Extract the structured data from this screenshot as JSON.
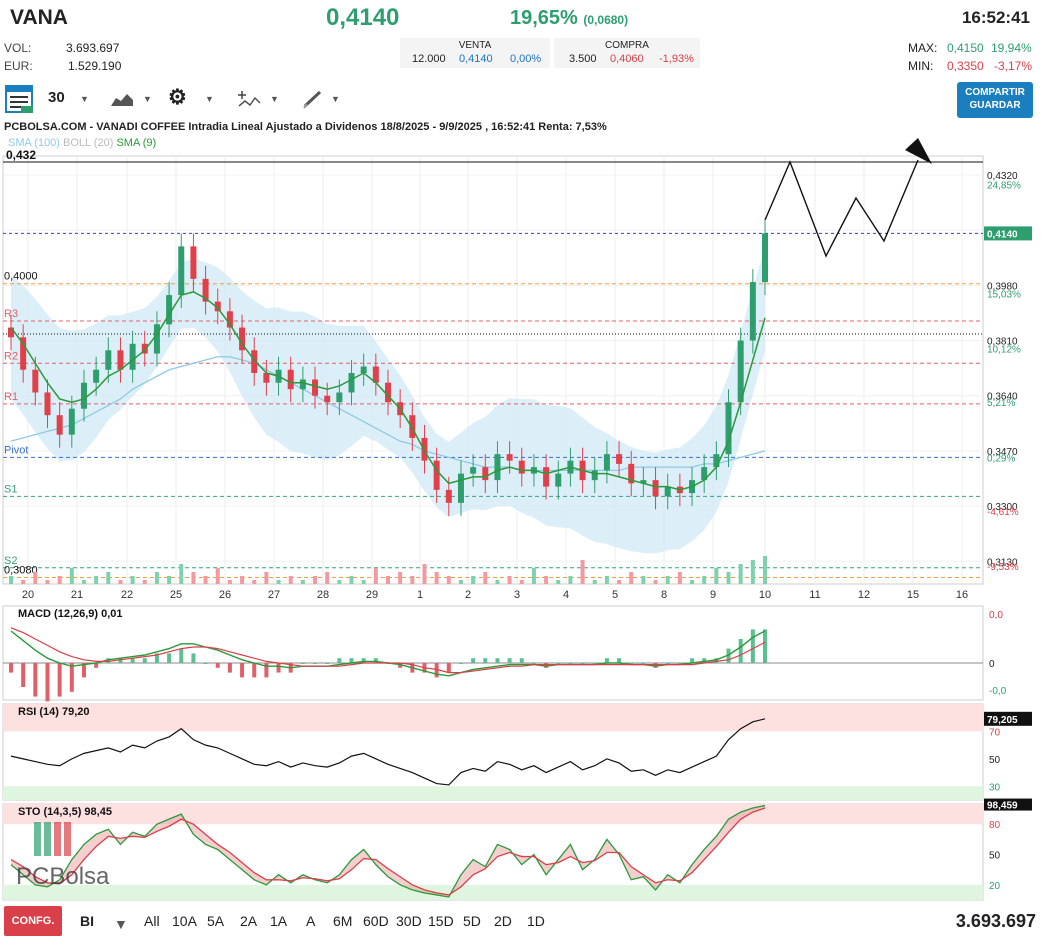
{
  "header": {
    "ticker": "VANA",
    "price": "0,4140",
    "change_pct": "19,65%",
    "change_abs": "(0,0680)",
    "time": "16:52:41",
    "vol_label": "VOL:",
    "vol_value": "3.693.697",
    "eur_label": "EUR:",
    "eur_value": "1.529.190",
    "venta": {
      "label": "VENTA",
      "qty": "12.000",
      "price": "0,4140",
      "pct": "0,00%"
    },
    "compra": {
      "label": "COMPRA",
      "qty": "3.500",
      "price": "0,4060",
      "pct": "-1,93%"
    },
    "max_label": "MAX:",
    "max_value": "0,4150",
    "max_pct": "19,94%",
    "min_label": "MIN:",
    "min_value": "0,3350",
    "min_pct": "-3,17%"
  },
  "toolbar": {
    "interval": "30",
    "share_line1": "COMPARTIR",
    "share_line2": "GUARDAR"
  },
  "chart_title": "PCBOLSA.COM - VANADI COFFEE Intradia Lineal Ajustado a Dividenos 18/8/2025 - 9/9/2025 , 16:52:41 Renta: 7,53%",
  "indicators": {
    "sma100": "SMA (100)",
    "boll": "BOLL (20)",
    "sma9": "SMA (9)"
  },
  "colors": {
    "up": "#2e9e6e",
    "down": "#e0404a",
    "sma9": "#2a9a3a",
    "sma100": "#8ecae6",
    "boll": "#cde8f7"
  },
  "chart_data": [
    {
      "type": "candlestick",
      "name": "price",
      "x_ticks": [
        "20",
        "21",
        "22",
        "25",
        "26",
        "27",
        "28",
        "29",
        "1",
        "2",
        "3",
        "4",
        "5",
        "8",
        "9",
        "10",
        "11",
        "12",
        "15",
        "16"
      ],
      "y_ticks": [
        "0,4320",
        "0,4150",
        "0,3980",
        "0,3810",
        "0,3640",
        "0,3470",
        "0,3300",
        "0,3130"
      ],
      "pct_ticks": [
        "24,85%",
        "15,03%",
        "10,12%",
        "5,21%",
        "0,29%",
        "-4,61%",
        "-9,53%"
      ],
      "ylim": [
        0.306,
        0.436
      ],
      "last_value": "0,4140",
      "top_left_label": "0,432",
      "levels": [
        {
          "label": "0,4000",
          "value": 0.3985,
          "style": "orange"
        },
        {
          "label": "R3",
          "value": 0.387,
          "style": "red"
        },
        {
          "label": "",
          "value": 0.383,
          "style": "black-dotted"
        },
        {
          "label": "R2",
          "value": 0.374,
          "style": "red"
        },
        {
          "label": "R1",
          "value": 0.3615,
          "style": "red"
        },
        {
          "label": "Pivot",
          "value": 0.345,
          "style": "blue"
        },
        {
          "label": "S1",
          "value": 0.333,
          "style": "green"
        },
        {
          "label": "S2",
          "value": 0.311,
          "style": "green"
        },
        {
          "label": "0,3080",
          "value": 0.308,
          "style": "orange"
        }
      ],
      "close": [
        0.382,
        0.372,
        0.365,
        0.358,
        0.352,
        0.36,
        0.368,
        0.372,
        0.378,
        0.372,
        0.38,
        0.377,
        0.386,
        0.395,
        0.41,
        0.4,
        0.393,
        0.39,
        0.385,
        0.378,
        0.371,
        0.368,
        0.372,
        0.366,
        0.369,
        0.364,
        0.362,
        0.365,
        0.371,
        0.373,
        0.368,
        0.362,
        0.358,
        0.351,
        0.344,
        0.335,
        0.331,
        0.34,
        0.342,
        0.338,
        0.346,
        0.344,
        0.34,
        0.342,
        0.336,
        0.34,
        0.344,
        0.338,
        0.341,
        0.346,
        0.343,
        0.337,
        0.338,
        0.333,
        0.336,
        0.334,
        0.338,
        0.342,
        0.346,
        0.362,
        0.381,
        0.399,
        0.414
      ],
      "sma9": [
        0.385,
        0.38,
        0.374,
        0.368,
        0.363,
        0.362,
        0.363,
        0.366,
        0.37,
        0.372,
        0.375,
        0.378,
        0.383,
        0.389,
        0.395,
        0.396,
        0.394,
        0.391,
        0.386,
        0.38,
        0.375,
        0.371,
        0.37,
        0.368,
        0.368,
        0.367,
        0.366,
        0.367,
        0.369,
        0.371,
        0.368,
        0.364,
        0.36,
        0.354,
        0.347,
        0.341,
        0.337,
        0.338,
        0.339,
        0.339,
        0.341,
        0.342,
        0.341,
        0.341,
        0.34,
        0.341,
        0.342,
        0.341,
        0.34,
        0.34,
        0.339,
        0.338,
        0.337,
        0.336,
        0.336,
        0.335,
        0.336,
        0.338,
        0.342,
        0.35,
        0.362,
        0.375,
        0.388
      ],
      "sma100": [
        0.35,
        0.351,
        0.352,
        0.353,
        0.354,
        0.355,
        0.357,
        0.359,
        0.361,
        0.363,
        0.366,
        0.368,
        0.37,
        0.372,
        0.373,
        0.374,
        0.375,
        0.376,
        0.376,
        0.375,
        0.374,
        0.372,
        0.37,
        0.368,
        0.366,
        0.364,
        0.362,
        0.36,
        0.358,
        0.356,
        0.354,
        0.352,
        0.35,
        0.349,
        0.347,
        0.346,
        0.345,
        0.344,
        0.343,
        0.342,
        0.342,
        0.342,
        0.341,
        0.341,
        0.341,
        0.341,
        0.341,
        0.341,
        0.341,
        0.341,
        0.341,
        0.342,
        0.342,
        0.342,
        0.342,
        0.342,
        0.342,
        0.343,
        0.343,
        0.344,
        0.345,
        0.346,
        0.347
      ],
      "volume": [
        2,
        1,
        3,
        1,
        2,
        4,
        1,
        2,
        3,
        1,
        2,
        1,
        3,
        2,
        5,
        3,
        2,
        4,
        1,
        2,
        1,
        3,
        1,
        2,
        1,
        2,
        3,
        1,
        2,
        1,
        4,
        2,
        3,
        2,
        5,
        3,
        2,
        1,
        2,
        3,
        1,
        2,
        1,
        4,
        2,
        1,
        2,
        6,
        1,
        2,
        1,
        3,
        2,
        1,
        2,
        3,
        1,
        2,
        4,
        3,
        5,
        6,
        7
      ]
    },
    {
      "type": "line",
      "name": "MACD (12,26,9)",
      "value": "0,01",
      "y_ticks": [
        "0,0",
        "0",
        "-0,0"
      ],
      "macd": [
        0.02,
        0.014,
        0.008,
        0.003,
        0.0,
        -0.002,
        -0.001,
        0.0,
        0.002,
        0.003,
        0.004,
        0.005,
        0.007,
        0.009,
        0.012,
        0.012,
        0.01,
        0.008,
        0.005,
        0.002,
        0.0,
        -0.002,
        -0.002,
        -0.003,
        -0.002,
        -0.002,
        -0.002,
        -0.001,
        0.0,
        0.001,
        0.001,
        0.0,
        -0.001,
        -0.003,
        -0.005,
        -0.007,
        -0.008,
        -0.006,
        -0.004,
        -0.003,
        -0.002,
        -0.001,
        -0.001,
        -0.001,
        -0.002,
        -0.001,
        -0.001,
        -0.001,
        -0.001,
        0.0,
        0.0,
        -0.001,
        -0.001,
        -0.002,
        -0.001,
        -0.001,
        0.0,
        0.001,
        0.002,
        0.005,
        0.01,
        0.016,
        0.02
      ],
      "signal": [
        0.022,
        0.019,
        0.015,
        0.011,
        0.007,
        0.004,
        0.002,
        0.001,
        0.001,
        0.002,
        0.003,
        0.004,
        0.005,
        0.007,
        0.009,
        0.01,
        0.01,
        0.009,
        0.007,
        0.005,
        0.003,
        0.001,
        0.0,
        -0.001,
        -0.002,
        -0.002,
        -0.002,
        -0.002,
        -0.001,
        0.0,
        0.0,
        0.0,
        0.0,
        -0.001,
        -0.003,
        -0.004,
        -0.006,
        -0.006,
        -0.005,
        -0.004,
        -0.003,
        -0.002,
        -0.002,
        -0.001,
        -0.001,
        -0.001,
        -0.001,
        -0.001,
        -0.001,
        -0.001,
        -0.001,
        -0.001,
        -0.001,
        -0.001,
        -0.001,
        -0.001,
        -0.001,
        0.0,
        0.001,
        0.002,
        0.005,
        0.009,
        0.013
      ]
    },
    {
      "type": "line",
      "name": "RSI (14)",
      "value": "79,20",
      "last_value": "79,205",
      "y_ticks": [
        "70",
        "50",
        "30"
      ],
      "values": [
        52,
        50,
        48,
        46,
        45,
        50,
        54,
        56,
        58,
        55,
        60,
        58,
        63,
        66,
        72,
        64,
        60,
        58,
        54,
        50,
        46,
        45,
        48,
        44,
        47,
        45,
        44,
        47,
        52,
        54,
        50,
        46,
        43,
        40,
        36,
        32,
        31,
        40,
        43,
        41,
        48,
        46,
        42,
        45,
        40,
        44,
        48,
        42,
        45,
        50,
        47,
        41,
        42,
        38,
        42,
        40,
        44,
        48,
        52,
        64,
        72,
        77,
        79.2
      ]
    },
    {
      "type": "line",
      "name": "STO (14,3,5)",
      "value": "98,45",
      "last_value": "98,459",
      "y_ticks": [
        "80",
        "50",
        "20"
      ],
      "k": [
        40,
        30,
        20,
        18,
        25,
        45,
        60,
        70,
        75,
        60,
        72,
        68,
        80,
        85,
        90,
        70,
        60,
        55,
        45,
        35,
        25,
        20,
        30,
        22,
        30,
        25,
        22,
        30,
        45,
        55,
        40,
        28,
        20,
        15,
        12,
        10,
        8,
        30,
        45,
        38,
        60,
        55,
        40,
        50,
        30,
        45,
        60,
        35,
        45,
        65,
        50,
        25,
        28,
        15,
        30,
        22,
        40,
        55,
        68,
        85,
        92,
        96,
        98.45
      ],
      "d": [
        45,
        38,
        28,
        22,
        21,
        30,
        45,
        58,
        68,
        66,
        68,
        67,
        73,
        78,
        85,
        80,
        70,
        60,
        52,
        42,
        32,
        25,
        25,
        24,
        27,
        26,
        24,
        26,
        35,
        46,
        45,
        36,
        28,
        20,
        15,
        12,
        10,
        18,
        30,
        36,
        48,
        52,
        48,
        48,
        40,
        42,
        48,
        42,
        44,
        52,
        52,
        38,
        30,
        22,
        25,
        24,
        32,
        45,
        58,
        72,
        85,
        92,
        96
      ]
    }
  ],
  "bottom": {
    "conf": "CONFG.",
    "bi": "BI",
    "periods": [
      "All",
      "10A",
      "5A",
      "2A",
      "1A",
      "A",
      "6M",
      "60D",
      "30D",
      "15D",
      "5D",
      "2D",
      "1D"
    ],
    "volume_total": "3.693.697"
  }
}
